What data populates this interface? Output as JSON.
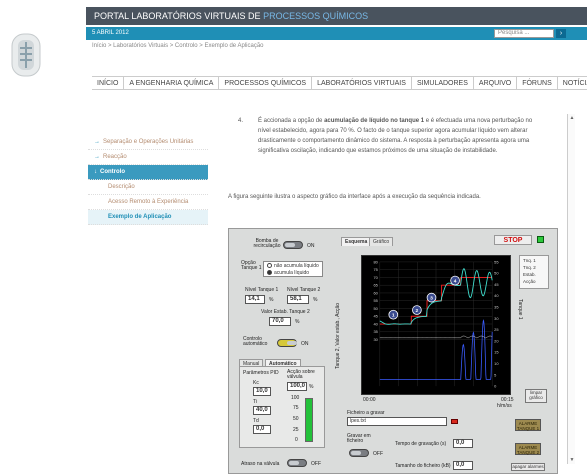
{
  "header": {
    "portal_title": "PORTAL LABORATÓRIOS VIRTUAIS DE",
    "portal_title_hl": "PROCESSOS QUÍMICOS",
    "date": "5 ABRIL 2012",
    "search_placeholder": "Pesquisa ..."
  },
  "breadcrumb": "Início > Laboratórios Virtuais > Controlo > Exemplo de Aplicação",
  "nav": [
    "INÍCIO",
    "A ENGENHARIA QUÍMICA",
    "PROCESSOS QUÍMICOS",
    "LABORATÓRIOS VIRTUAIS",
    "SIMULADORES",
    "ARQUIVO",
    "FÓRUNS",
    "NOTÍCIAS"
  ],
  "subnav": {
    "items": [
      {
        "label": "Separação e Operações Unitárias"
      },
      {
        "label": "Reacção"
      },
      {
        "label": "Controlo"
      },
      {
        "label": "Descrição"
      },
      {
        "label": "Acesso Remoto à Experiência"
      },
      {
        "label": "Exemplo de Aplicação"
      }
    ]
  },
  "content": {
    "item_number": "4.",
    "item_text_a": "É accionada a opção de ",
    "item_text_b": "acumulação de líquido no tanque 1",
    "item_text_c": " e é efectuada uma nova perturbação no nível estabelecido, agora para 70 %. O facto de o tanque superior agora acumular líquido vem alterar drasticamente o comportamento dinâmico do sistema. A resposta à perturbação apresenta agora uma significativa oscilação, indicando que estamos próximos de uma situação de instabilidade.",
    "figure_caption": "A figura seguinte ilustra o aspecto gráfico da interface após a execução da sequência indicada."
  },
  "lv": {
    "bomba_label": "Bomba de recirculação",
    "on": "ON",
    "off": "OFF",
    "opcao_label": "Opção Tanque 1",
    "radio1": "não acumula líquido",
    "radio2": "acumula líquido",
    "nivel1_label": "Nível Tanque 1",
    "nivel2_label": "Nível Tanque 2",
    "nivel1": "14,1",
    "nivel2": "58,1",
    "pct": "%",
    "valor_label": "Valor Estab. Tanque 2",
    "valor": "70,0",
    "controlo_label": "Controlo automático",
    "tab_manual": "Manual",
    "tab_auto": "Automático",
    "pid_label": "Parâmetros PID",
    "kc": "Kc",
    "kc_val": "10,0",
    "ti": "Ti",
    "ti_val": "40,0",
    "td": "Td",
    "td_val": "0,0",
    "accao_label": "Acção sobre válvula",
    "accao_val": "100,0",
    "tank_scale": [
      "100",
      "75",
      "50",
      "25",
      "0"
    ],
    "atraso_label": "Atraso na válvula",
    "graph_tabs": [
      "Esquema",
      "Gráfico"
    ],
    "stop": "STOP",
    "legend": [
      "Tnq. 1",
      "Tnq. 2",
      "Estab.",
      "Acção"
    ],
    "ylabel_left": "Tanque 2, Valor estab., Acção",
    "ylabel_right": "Tanque 1",
    "xtick_left": "00:00",
    "xtick_right": "00:15",
    "xunit": "h/m/ss",
    "limpar": "limpar gráfico",
    "ficheiro_label": "Ficheiro a gravar",
    "ficheiro_val": "lpes.txt",
    "gravar_label": "Gravar em ficheiro",
    "tempo_label": "Tempo de gravação (s)",
    "tempo_val": "0,0",
    "tamanho_label": "Tamanho do ficheiro (kB)",
    "tamanho_val": "0,0",
    "alarme1": "ALARME TANQUE 1",
    "alarme2": "ALARME TANQUE 2",
    "apagar": "apagar alarmes",
    "markers": [
      "1",
      "2",
      "3",
      "4"
    ]
  },
  "chart_data": {
    "type": "line",
    "ylim_left": [
      0,
      80
    ],
    "ylim_right": [
      0,
      55
    ],
    "yticks_left": [
      80,
      75,
      70,
      65,
      60,
      55,
      50,
      45,
      40,
      35,
      30
    ],
    "yticks_right": [
      55,
      50,
      45,
      40,
      35,
      30,
      25,
      20,
      15,
      10,
      5,
      0
    ],
    "series": [
      {
        "name": "Tnq. 1",
        "color": "#3a5cff"
      },
      {
        "name": "Tnq. 2",
        "color": "#40e0d0"
      },
      {
        "name": "Estab.",
        "color": "#ff2020"
      },
      {
        "name": "Acção",
        "color": "#ffffff"
      }
    ]
  },
  "colors": {
    "topbar": "#49535e",
    "datebar": "#1f8fb6",
    "accent": "#78b8e6",
    "stop": "#d01010",
    "led": "#2cc93b"
  }
}
